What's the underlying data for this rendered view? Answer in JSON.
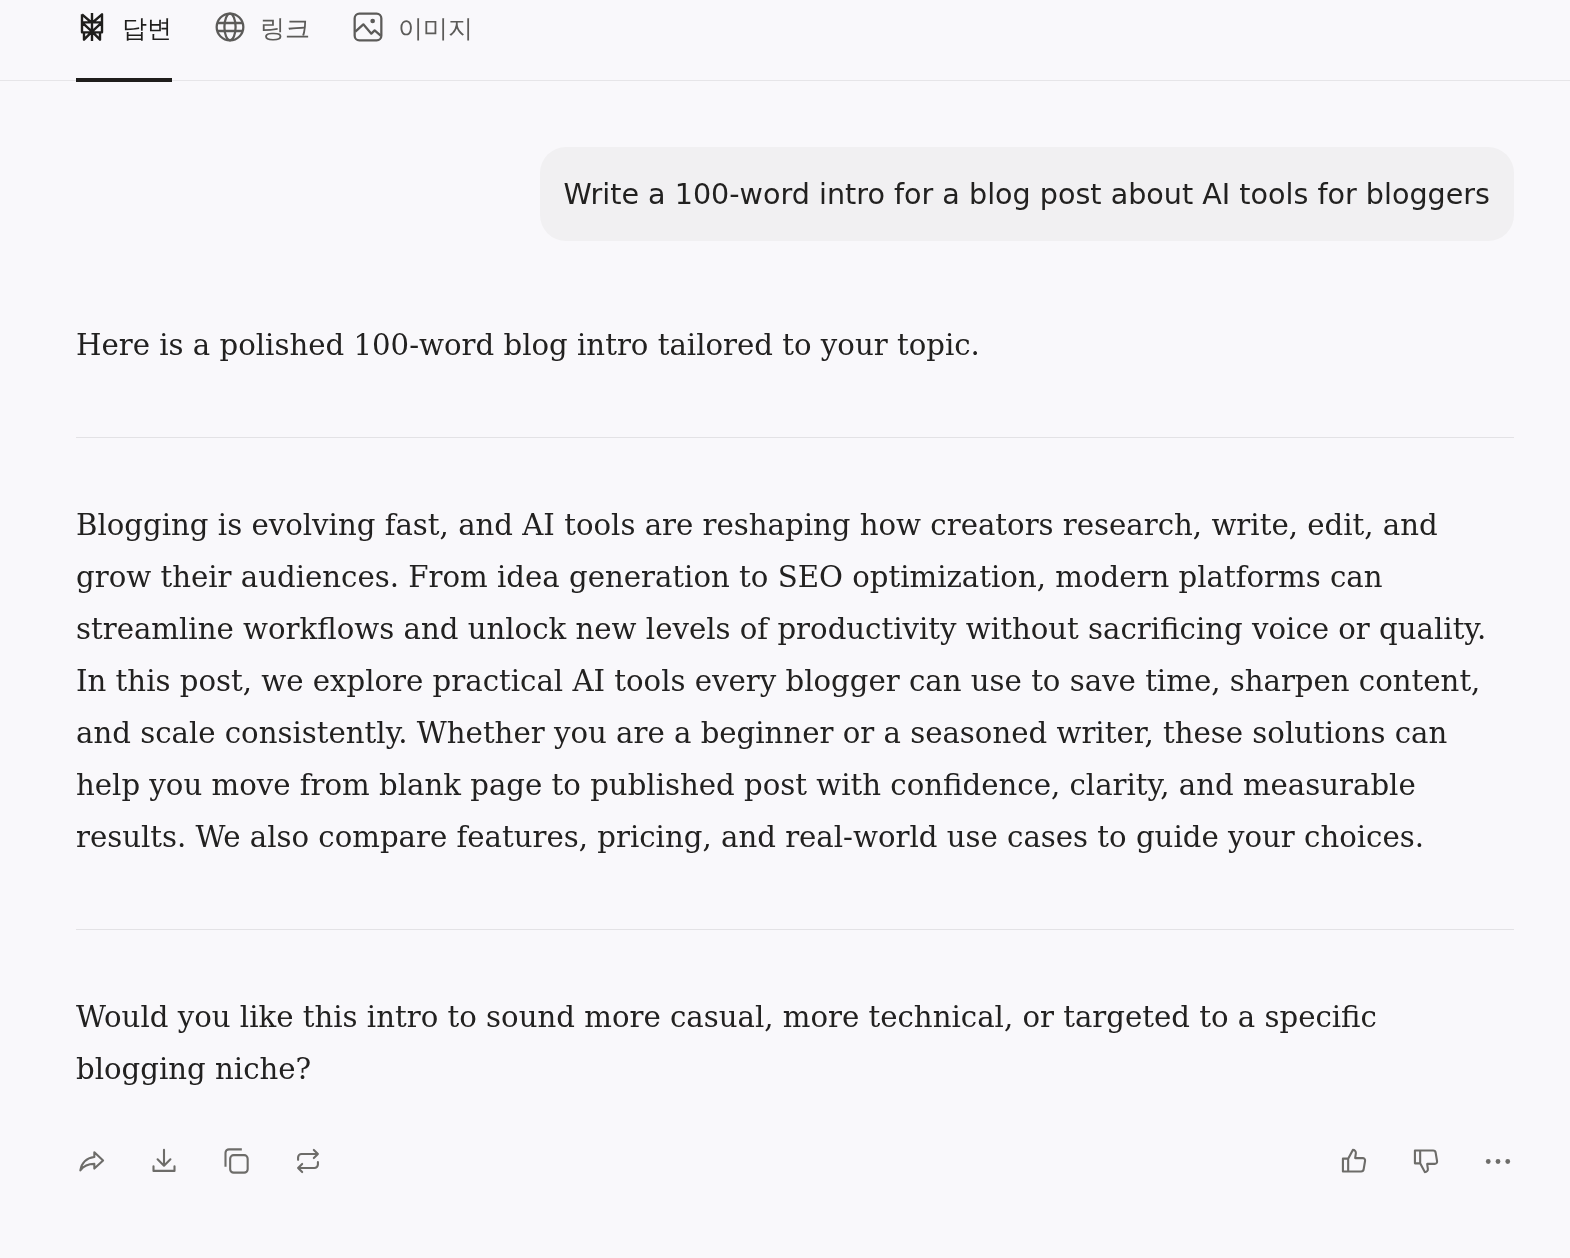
{
  "tabs": [
    {
      "label": "답변",
      "kind": "answer",
      "selected": true
    },
    {
      "label": "링크",
      "kind": "links",
      "selected": false
    },
    {
      "label": "이미지",
      "kind": "images",
      "selected": false
    }
  ],
  "user_message": {
    "text": "Write a 100-word intro for a blog post about AI tools for bloggers"
  },
  "response": {
    "paragraphs": [
      "Here is a polished 100-word blog intro tailored to your topic.",
      "Blogging is evolving fast, and AI tools are reshaping how creators research, write, edit, and grow their audiences. From idea generation to SEO optimization, modern platforms can streamline workflows and unlock new levels of productivity without sacrificing voice or quality. In this post, we explore practical AI tools every blogger can use to save time, sharpen content, and scale consistently. Whether you are a beginner or a seasoned writer, these solutions can help you move from blank page to published post with confidence, clarity, and measurable results. We also compare features, pricing, and real-world use cases to guide your choices.",
      "Would you like this intro to sound more casual, more technical, or targeted to a specific blogging niche?"
    ]
  }
}
